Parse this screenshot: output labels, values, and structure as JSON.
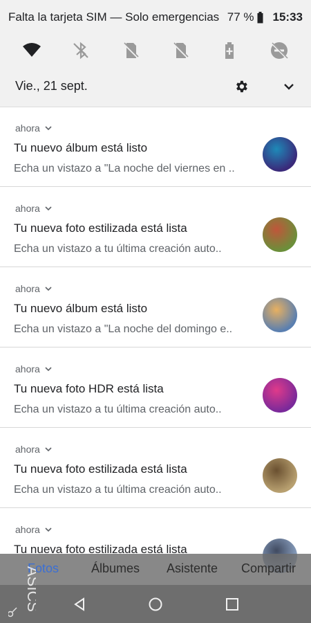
{
  "status_bar": {
    "carrier_text": "Falta la tarjeta SIM — Solo emergencias",
    "battery_percent": "77 %",
    "time": "15:33"
  },
  "quick_settings": {
    "icons": [
      "wifi-icon",
      "bluetooth-off-icon",
      "sim-off-icon",
      "sim-off-icon",
      "battery-saver-icon",
      "do-not-disturb-icon"
    ]
  },
  "shade_header": {
    "date": "Vie., 21 sept."
  },
  "notifications": [
    {
      "time": "ahora",
      "title": "Tu nuevo álbum está listo",
      "body": "Echa un vistazo a \"La noche del viernes en ..",
      "thumb_colors": [
        "#3a2a7a",
        "#1e8ab8"
      ]
    },
    {
      "time": "ahora",
      "title": "Tu nueva foto estilizada está lista",
      "body": "Echa un vistazo a tu última creación auto..",
      "thumb_colors": [
        "#6b8f3a",
        "#c0563a"
      ]
    },
    {
      "time": "ahora",
      "title": "Tu nuevo álbum está listo",
      "body": "Echa un vistazo a \"La noche del domingo e..",
      "thumb_colors": [
        "#5a7fb0",
        "#e8b060"
      ]
    },
    {
      "time": "ahora",
      "title": "Tu nueva foto HDR está lista",
      "body": "Echa un vistazo a tu última creación auto..",
      "thumb_colors": [
        "#7a2a9a",
        "#e03a8a"
      ]
    },
    {
      "time": "ahora",
      "title": "Tu nueva foto estilizada está lista",
      "body": "Echa un vistazo a tu última creación auto..",
      "thumb_colors": [
        "#b8a070",
        "#6a5030"
      ]
    },
    {
      "time": "ahora",
      "title": "Tu nueva foto estilizada está lista",
      "body": "",
      "thumb_colors": [
        "#8aa0c0",
        "#404a60"
      ]
    }
  ],
  "app_tabs": {
    "photos": "Fotos",
    "albums": "Álbumes",
    "assistant": "Asistente",
    "share": "Compartir"
  },
  "watermark_text": "ASICS",
  "colors": {
    "shade_bg": "#f1f1f1",
    "tab_active": "#3b6fd4",
    "navbar": "#6e6e6e"
  }
}
